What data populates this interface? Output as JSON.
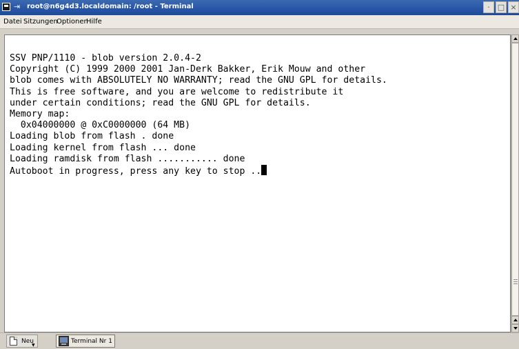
{
  "window": {
    "title": "root@n6g4d3.localdomain: /root - Terminal",
    "pin_glyph": "⇥",
    "title_buttons": [
      "·",
      "□",
      "×"
    ]
  },
  "menu": {
    "items": [
      "Datei",
      "Sitzungen",
      "Optionen",
      "Hilfe"
    ]
  },
  "terminal": {
    "lines": [
      "SSV PNP/1110 - blob version 2.0.4-2",
      "Copyright (C) 1999 2000 2001 Jan-Derk Bakker, Erik Mouw and other",
      "blob comes with ABSOLUTELY NO WARRANTY; read the GNU GPL for details.",
      "This is free software, and you are welcome to redistribute it",
      "under certain conditions; read the GNU GPL for details.",
      "Memory map:",
      "  0x04000000 @ 0xC0000000 (64 MB)",
      "Loading blob from flash . done",
      "Loading kernel from flash ... done",
      "Loading ramdisk from flash ........... done",
      "Autoboot in progress, press any key to stop .."
    ]
  },
  "tabbar": {
    "new_label": "Neu",
    "tabs": [
      "Terminal Nr 1"
    ]
  },
  "icons": {
    "window_menu": "window-menu-icon",
    "pin": "pin-icon",
    "new_tab": "document-new-icon",
    "terminal": "terminal-icon"
  }
}
